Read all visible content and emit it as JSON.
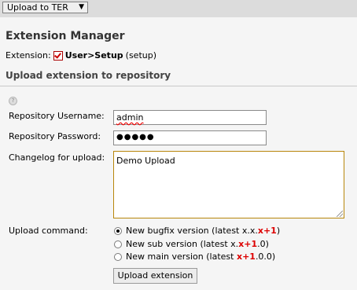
{
  "topbar": {
    "menu_label": "Upload to TER",
    "menu_arrow": "▼"
  },
  "page_title": "Extension Manager",
  "extension": {
    "label": "Extension:",
    "icon": "checkbox-extension-icon",
    "title": "User>Setup",
    "key": "(setup)"
  },
  "section_title": "Upload extension to repository",
  "form": {
    "username_label": "Repository Username:",
    "username_value": "admin",
    "password_label": "Repository Password:",
    "password_value": "●●●●●",
    "changelog_label": "Changelog for upload:",
    "changelog_value": "Demo Upload",
    "command_label": "Upload command:",
    "options": [
      {
        "prefix": "New bugfix version (latest x.x.",
        "highlight": "x+1",
        "suffix": ")",
        "checked": true
      },
      {
        "prefix": "New sub version (latest x.",
        "highlight": "x+1",
        "suffix": ".0)",
        "checked": false
      },
      {
        "prefix": "New main version (latest ",
        "highlight": "x+1",
        "suffix": ".0.0)",
        "checked": false
      }
    ],
    "submit_label": "Upload extension"
  },
  "colors": {
    "highlight": "#d00000",
    "changelog_border": "#b8860b"
  }
}
